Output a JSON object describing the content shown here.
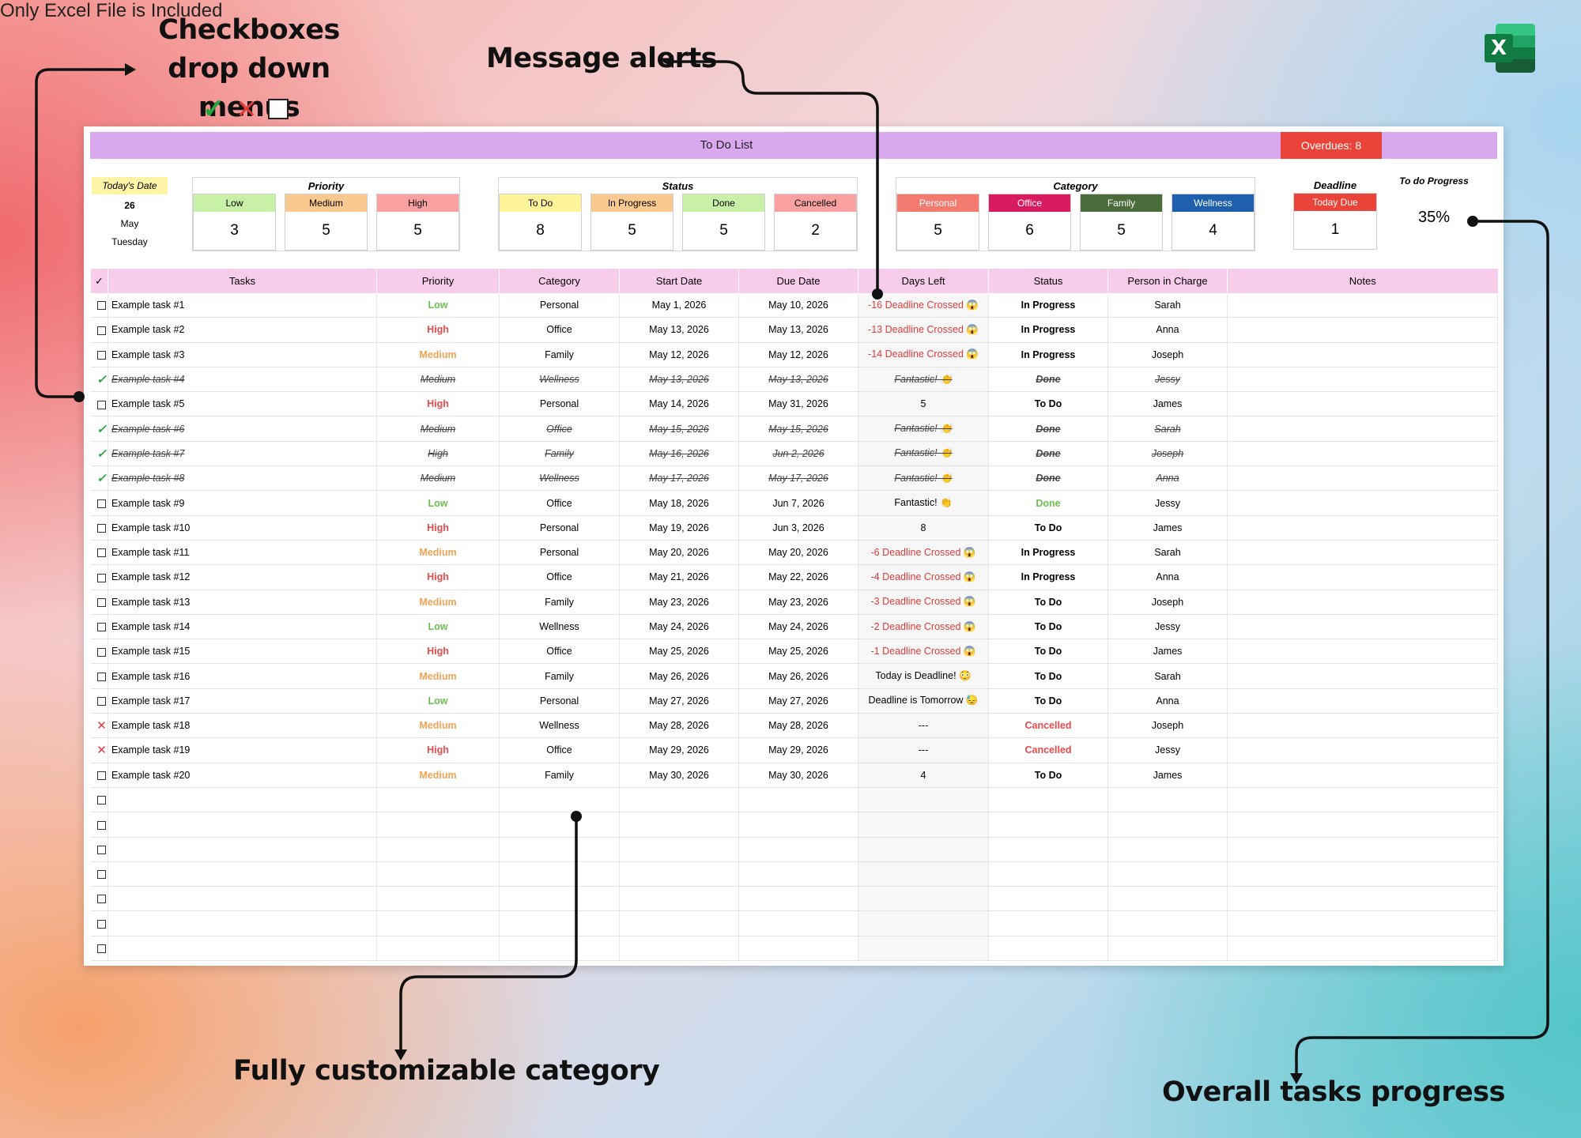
{
  "annotations": {
    "checkboxes_line1": "Checkboxes",
    "checkboxes_line2": "drop down menus",
    "alerts": "Message alerts",
    "category": "Fully customizable category",
    "progress": "Overall tasks progress",
    "excel": "Only Excel File is Included",
    "excel_letter": "X"
  },
  "sheet": {
    "title": "To Do List",
    "overdues": "Overdues: 8",
    "today": {
      "label": "Today's Date",
      "day": "26",
      "month": "May",
      "weekday": "Tuesday"
    },
    "priority": {
      "title": "Priority",
      "cards": [
        {
          "label": "Low",
          "value": "3",
          "color": "#c8f0a6"
        },
        {
          "label": "Medium",
          "value": "5",
          "color": "#f9c98f"
        },
        {
          "label": "High",
          "value": "5",
          "color": "#f9a1a0"
        }
      ]
    },
    "status": {
      "title": "Status",
      "cards": [
        {
          "label": "To Do",
          "value": "8",
          "color": "#fff39a"
        },
        {
          "label": "In Progress",
          "value": "5",
          "color": "#f9c98f"
        },
        {
          "label": "Done",
          "value": "5",
          "color": "#c8f0a6"
        },
        {
          "label": "Cancelled",
          "value": "2",
          "color": "#f9a1a0"
        }
      ]
    },
    "category": {
      "title": "Category",
      "cards": [
        {
          "label": "Personal",
          "value": "5",
          "color": "#f27a6f"
        },
        {
          "label": "Office",
          "value": "6",
          "color": "#d81b60"
        },
        {
          "label": "Family",
          "value": "5",
          "color": "#4a6b3a"
        },
        {
          "label": "Wellness",
          "value": "4",
          "color": "#1e5fae"
        }
      ]
    },
    "deadline": {
      "title": "Deadline",
      "label": "Today Due",
      "value": "1",
      "color": "#ea4339"
    },
    "progress": {
      "label": "To do Progress",
      "value": "35%"
    },
    "columns": [
      "✓",
      "Tasks",
      "Priority",
      "Category",
      "Start Date",
      "Due Date",
      "Days Left",
      "Status",
      "Person in Charge",
      "Notes"
    ],
    "rows": [
      {
        "mark": "box",
        "task": "Example task #1",
        "priority": "Low",
        "category": "Personal",
        "start": "May 1, 2026",
        "due": "May 10, 2026",
        "days": "-16 Deadline Crossed 😱",
        "status": "In Progress",
        "person": "Sarah"
      },
      {
        "mark": "box",
        "task": "Example task #2",
        "priority": "High",
        "category": "Office",
        "start": "May 13, 2026",
        "due": "May 13, 2026",
        "days": "-13 Deadline Crossed 😱",
        "status": "In Progress",
        "person": "Anna"
      },
      {
        "mark": "box",
        "task": "Example task #3",
        "priority": "Medium",
        "category": "Family",
        "start": "May 12, 2026",
        "due": "May 12, 2026",
        "days": "-14 Deadline Crossed 😱",
        "status": "In Progress",
        "person": "Joseph"
      },
      {
        "mark": "check",
        "task": "Example task #4",
        "priority": "Medium",
        "category": "Wellness",
        "start": "May 13, 2026",
        "due": "May 13, 2026",
        "days": "Fantastic! 👏",
        "status": "Done",
        "person": "Jessy"
      },
      {
        "mark": "box",
        "task": "Example task #5",
        "priority": "High",
        "category": "Personal",
        "start": "May 14, 2026",
        "due": "May 31, 2026",
        "days": "5",
        "status": "To Do",
        "person": "James"
      },
      {
        "mark": "check",
        "task": "Example task #6",
        "priority": "Medium",
        "category": "Office",
        "start": "May 15, 2026",
        "due": "May 15, 2026",
        "days": "Fantastic! 👏",
        "status": "Done",
        "person": "Sarah"
      },
      {
        "mark": "check",
        "task": "Example task #7",
        "priority": "High",
        "category": "Family",
        "start": "May 16, 2026",
        "due": "Jun 2, 2026",
        "days": "Fantastic! 👏",
        "status": "Done",
        "person": "Joseph"
      },
      {
        "mark": "check",
        "task": "Example task #8",
        "priority": "Medium",
        "category": "Wellness",
        "start": "May 17, 2026",
        "due": "May 17, 2026",
        "days": "Fantastic! 👏",
        "status": "Done",
        "person": "Anna"
      },
      {
        "mark": "box",
        "task": "Example task #9",
        "priority": "Low",
        "category": "Office",
        "start": "May 18, 2026",
        "due": "Jun 7, 2026",
        "days": "Fantastic! 👏",
        "status": "Done",
        "person": "Jessy",
        "green": true
      },
      {
        "mark": "box",
        "task": "Example task #10",
        "priority": "High",
        "category": "Personal",
        "start": "May 19, 2026",
        "due": "Jun 3, 2026",
        "days": "8",
        "status": "To Do",
        "person": "James"
      },
      {
        "mark": "box",
        "task": "Example task #11",
        "priority": "Medium",
        "category": "Personal",
        "start": "May 20, 2026",
        "due": "May 20, 2026",
        "days": "-6 Deadline Crossed 😱",
        "status": "In Progress",
        "person": "Sarah"
      },
      {
        "mark": "box",
        "task": "Example task #12",
        "priority": "High",
        "category": "Office",
        "start": "May 21, 2026",
        "due": "May 22, 2026",
        "days": "-4 Deadline Crossed 😱",
        "status": "In Progress",
        "person": "Anna"
      },
      {
        "mark": "box",
        "task": "Example task #13",
        "priority": "Medium",
        "category": "Family",
        "start": "May 23, 2026",
        "due": "May 23, 2026",
        "days": "-3 Deadline Crossed 😱",
        "status": "To Do",
        "person": "Joseph"
      },
      {
        "mark": "box",
        "task": "Example task #14",
        "priority": "Low",
        "category": "Wellness",
        "start": "May 24, 2026",
        "due": "May 24, 2026",
        "days": "-2 Deadline Crossed 😱",
        "status": "To Do",
        "person": "Jessy"
      },
      {
        "mark": "box",
        "task": "Example task #15",
        "priority": "High",
        "category": "Office",
        "start": "May 25, 2026",
        "due": "May 25, 2026",
        "days": "-1 Deadline Crossed 😱",
        "status": "To Do",
        "person": "James"
      },
      {
        "mark": "box",
        "task": "Example task #16",
        "priority": "Medium",
        "category": "Family",
        "start": "May 26, 2026",
        "due": "May 26, 2026",
        "days": "Today is Deadline! 😳",
        "status": "To Do",
        "person": "Sarah"
      },
      {
        "mark": "box",
        "task": "Example task #17",
        "priority": "Low",
        "category": "Personal",
        "start": "May 27, 2026",
        "due": "May 27, 2026",
        "days": "Deadline is Tomorrow 😓",
        "status": "To Do",
        "person": "Anna"
      },
      {
        "mark": "x",
        "task": "Example task #18",
        "priority": "Medium",
        "category": "Wellness",
        "start": "May 28, 2026",
        "due": "May 28, 2026",
        "days": "---",
        "status": "Cancelled",
        "person": "Joseph"
      },
      {
        "mark": "x",
        "task": "Example task #19",
        "priority": "High",
        "category": "Office",
        "start": "May 29, 2026",
        "due": "May 29, 2026",
        "days": "---",
        "status": "Cancelled",
        "person": "Jessy"
      },
      {
        "mark": "box",
        "task": "Example task #20",
        "priority": "Medium",
        "category": "Family",
        "start": "May 30, 2026",
        "due": "May 30, 2026",
        "days": "4",
        "status": "To Do",
        "person": "James"
      },
      {
        "mark": "box",
        "task": "",
        "priority": "",
        "category": "",
        "start": "",
        "due": "",
        "days": "",
        "status": "",
        "person": ""
      },
      {
        "mark": "box",
        "task": "",
        "priority": "",
        "category": "",
        "start": "",
        "due": "",
        "days": "",
        "status": "",
        "person": ""
      },
      {
        "mark": "box",
        "task": "",
        "priority": "",
        "category": "",
        "start": "",
        "due": "",
        "days": "",
        "status": "",
        "person": ""
      },
      {
        "mark": "box",
        "task": "",
        "priority": "",
        "category": "",
        "start": "",
        "due": "",
        "days": "",
        "status": "",
        "person": ""
      },
      {
        "mark": "box",
        "task": "",
        "priority": "",
        "category": "",
        "start": "",
        "due": "",
        "days": "",
        "status": "",
        "person": ""
      },
      {
        "mark": "box",
        "task": "",
        "priority": "",
        "category": "",
        "start": "",
        "due": "",
        "days": "",
        "status": "",
        "person": ""
      },
      {
        "mark": "box",
        "task": "",
        "priority": "",
        "category": "",
        "start": "",
        "due": "",
        "days": "",
        "status": "",
        "person": ""
      }
    ]
  }
}
